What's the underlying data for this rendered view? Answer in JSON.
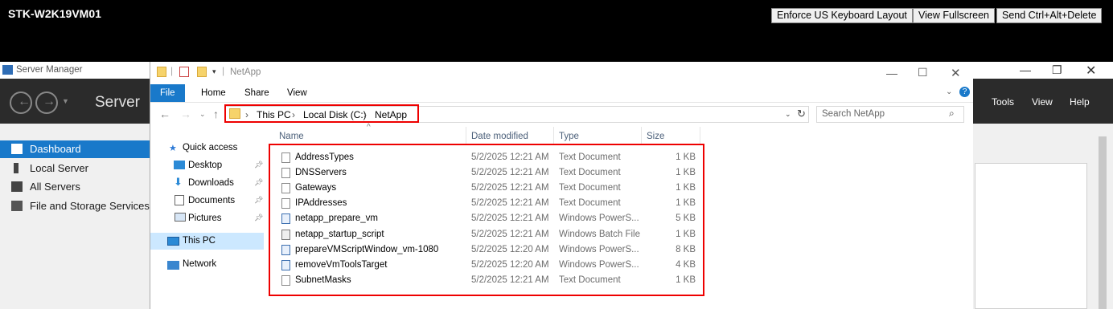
{
  "remote": {
    "vm_name": "STK-W2K19VM01",
    "buttons": [
      "Enforce US Keyboard Layout",
      "View Fullscreen",
      "Send Ctrl+Alt+Delete"
    ]
  },
  "server_manager": {
    "window_title": "Server Manager",
    "heading": "Server",
    "menu": [
      "Tools",
      "View",
      "Help"
    ],
    "nav": [
      {
        "label": "Dashboard",
        "icon": "dashboard-icon",
        "active": true
      },
      {
        "label": "Local Server",
        "icon": "server-icon",
        "active": false
      },
      {
        "label": "All Servers",
        "icon": "servers-icon",
        "active": false
      },
      {
        "label": "File and Storage Services",
        "icon": "storage-icon",
        "active": false
      }
    ]
  },
  "explorer": {
    "window_title": "NetApp",
    "ribbon_tabs": [
      "File",
      "Home",
      "Share",
      "View"
    ],
    "breadcrumb": [
      "This PC",
      "Local Disk (C:)",
      "NetApp"
    ],
    "search_placeholder": "Search NetApp",
    "nav_items": [
      {
        "label": "Quick access",
        "icon": "star-icon"
      },
      {
        "label": "Desktop",
        "icon": "desktop-icon",
        "pinned": true
      },
      {
        "label": "Downloads",
        "icon": "download-icon",
        "pinned": true
      },
      {
        "label": "Documents",
        "icon": "documents-icon",
        "pinned": true
      },
      {
        "label": "Pictures",
        "icon": "pictures-icon",
        "pinned": true
      },
      {
        "label": "This PC",
        "icon": "computer-icon",
        "selected": true
      },
      {
        "label": "Network",
        "icon": "network-icon"
      }
    ],
    "columns": [
      "Name",
      "Date modified",
      "Type",
      "Size"
    ],
    "files": [
      {
        "name": "AddressTypes",
        "date": "5/2/2025 12:21 AM",
        "type": "Text Document",
        "size": "1 KB",
        "icon": "text-file-icon"
      },
      {
        "name": "DNSServers",
        "date": "5/2/2025 12:21 AM",
        "type": "Text Document",
        "size": "1 KB",
        "icon": "text-file-icon"
      },
      {
        "name": "Gateways",
        "date": "5/2/2025 12:21 AM",
        "type": "Text Document",
        "size": "1 KB",
        "icon": "text-file-icon"
      },
      {
        "name": "IPAddresses",
        "date": "5/2/2025 12:21 AM",
        "type": "Text Document",
        "size": "1 KB",
        "icon": "text-file-icon"
      },
      {
        "name": "netapp_prepare_vm",
        "date": "5/2/2025 12:21 AM",
        "type": "Windows PowerS...",
        "size": "5 KB",
        "icon": "powershell-file-icon"
      },
      {
        "name": "netapp_startup_script",
        "date": "5/2/2025 12:21 AM",
        "type": "Windows Batch File",
        "size": "1 KB",
        "icon": "batch-file-icon"
      },
      {
        "name": "prepareVMScriptWindow_vm-1080",
        "date": "5/2/2025 12:20 AM",
        "type": "Windows PowerS...",
        "size": "8 KB",
        "icon": "powershell-file-icon"
      },
      {
        "name": "removeVmToolsTarget",
        "date": "5/2/2025 12:20 AM",
        "type": "Windows PowerS...",
        "size": "4 KB",
        "icon": "powershell-file-icon"
      },
      {
        "name": "SubnetMasks",
        "date": "5/2/2025 12:21 AM",
        "type": "Text Document",
        "size": "1 KB",
        "icon": "text-file-icon"
      }
    ]
  },
  "colors": {
    "accent": "#1979ca",
    "highlight": "#e00000",
    "header_dark": "#2b2b2b"
  }
}
